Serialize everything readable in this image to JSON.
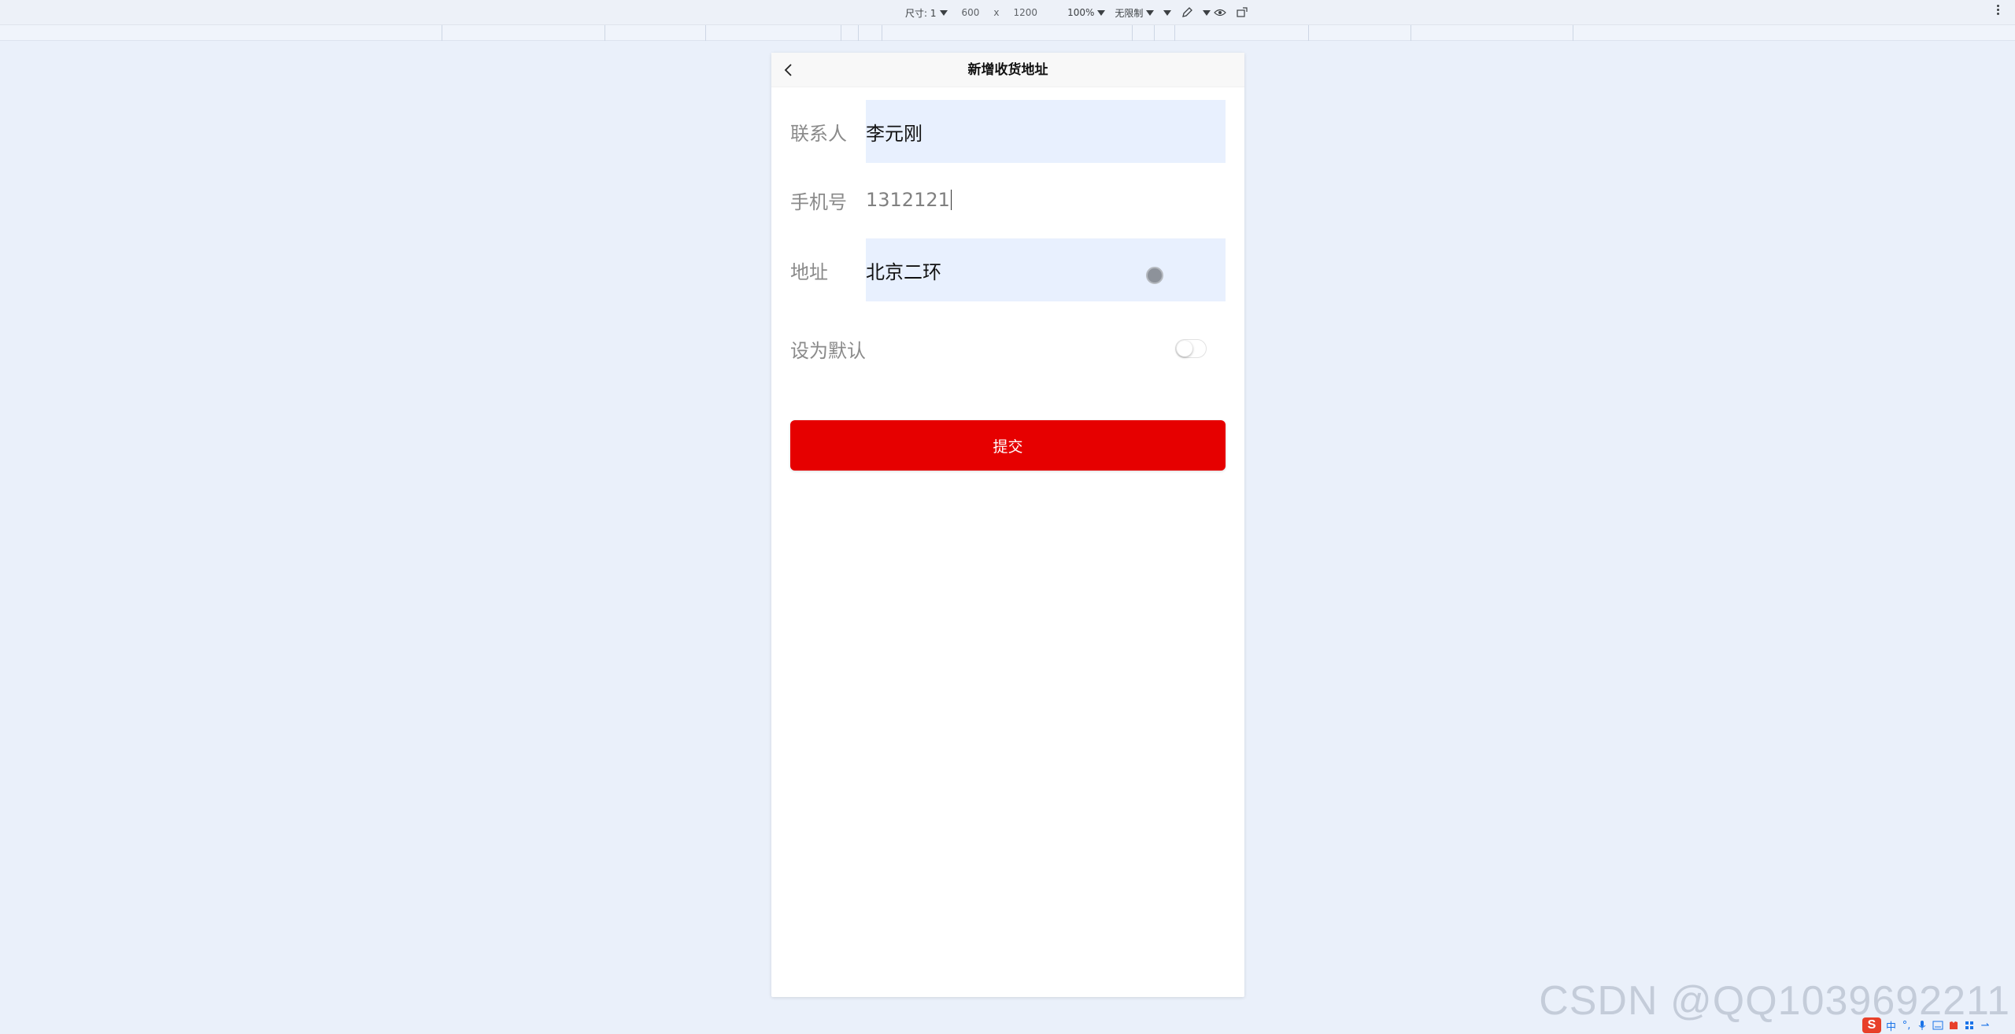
{
  "devtools": {
    "dimensions_label": "尺寸: 1",
    "width": "600",
    "times": "x",
    "height": "1200",
    "zoom": "100%",
    "throttle": "无限制",
    "icons": [
      "caret-down-icon",
      "pen-icon",
      "eye-icon",
      "rotate-icon",
      "more-vertical-icon"
    ]
  },
  "nav": {
    "title": "新增收货地址",
    "back_icon": "chevron-left-icon"
  },
  "form": {
    "contact_label": "联系人",
    "contact_value": "李元刚",
    "phone_label": "手机号",
    "phone_value": "1312121",
    "address_label": "地址",
    "address_value": "北京二环",
    "default_label": "设为默认",
    "default_on": false
  },
  "submit_label": "提交",
  "watermark": "CSDN @QQ1039692211",
  "tray": {
    "logo": "S",
    "lang": "中",
    "icons": [
      "punctuation-icon",
      "microphone-icon",
      "keyboard-icon",
      "skin-icon",
      "toolbox-icon",
      "arrow-icon"
    ]
  },
  "colors": {
    "primary_button": "#e60000",
    "autofill_bg": "#e8f0fe",
    "page_bg": "#eaf0fa"
  }
}
